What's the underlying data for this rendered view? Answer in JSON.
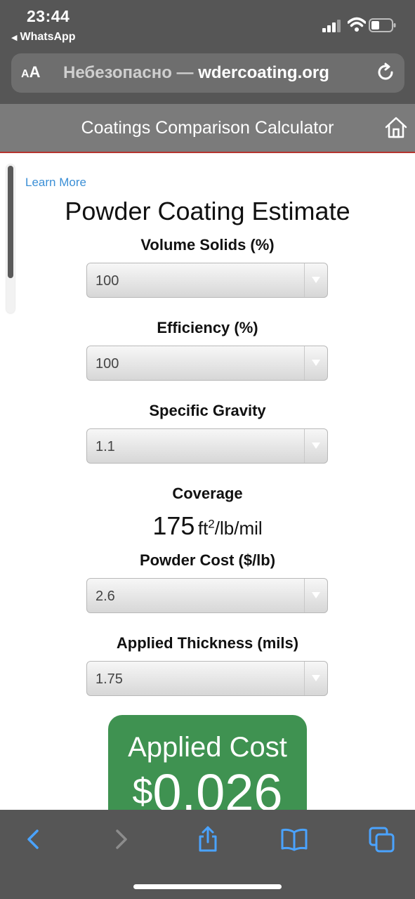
{
  "status_bar": {
    "time": "23:44",
    "back_app": "WhatsApp",
    "icons": [
      "cellular-signal-icon",
      "wifi-icon",
      "battery-icon"
    ]
  },
  "browser": {
    "text_size_label_small": "A",
    "text_size_label_large": "A",
    "url_prefix": "Небезопасно — ",
    "url_host": "wdercoating.org"
  },
  "header": {
    "title": "Coatings Comparison Calculator",
    "home_icon": "home-icon"
  },
  "page": {
    "learn_more": "Learn More",
    "title": "Powder Coating Estimate"
  },
  "fields": {
    "volume_solids": {
      "label": "Volume Solids (%)",
      "value": "100"
    },
    "efficiency": {
      "label": "Efficiency (%)",
      "value": "100"
    },
    "specific_gravity": {
      "label": "Specific Gravity",
      "value": "1.1"
    },
    "coverage": {
      "label": "Coverage",
      "value": "175",
      "unit_pre": "ft",
      "unit_sup": "2",
      "unit_post": "/lb/mil"
    },
    "powder_cost": {
      "label": "Powder Cost ($/lb)",
      "value": "2.6"
    },
    "applied_thickness": {
      "label": "Applied Thickness (mils)",
      "value": "1.75"
    }
  },
  "result": {
    "label": "Applied Cost",
    "currency": "$",
    "value": "0.026"
  },
  "colors": {
    "chrome": "#565656",
    "header": "#7b7b7b",
    "accent_line": "#b5342f",
    "link": "#3b8fd6",
    "cost_box": "#3f9251",
    "toolbar_icon": "#4aa3ff"
  },
  "toolbar": [
    "back-icon",
    "forward-icon",
    "share-icon",
    "bookmarks-icon",
    "tabs-icon"
  ]
}
